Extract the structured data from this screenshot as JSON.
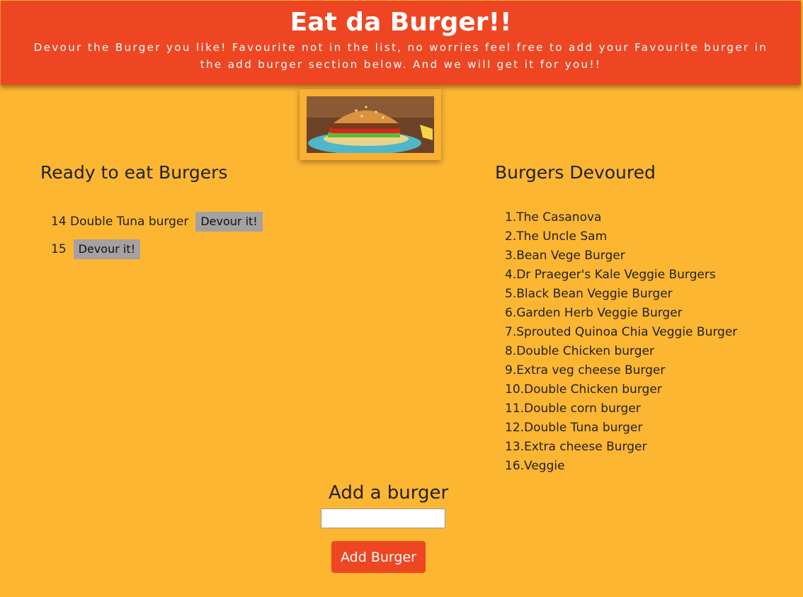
{
  "header": {
    "title": "Eat da Burger!!",
    "subtitle": "Devour the Burger you like! Favourite not in the list, no worries feel free to add your Favourite burger in the add burger section below. And we will get it for you!!"
  },
  "ready": {
    "title": "Ready to eat Burgers",
    "items": [
      {
        "label": "14 Double Tuna burger",
        "button": "Devour it!"
      },
      {
        "label": "15",
        "button": "Devour it!"
      }
    ]
  },
  "devoured": {
    "title": "Burgers Devoured",
    "items": [
      "1.The Casanova",
      "2.The Uncle Sam",
      "3.Bean Vege Burger",
      "4.Dr Praeger's Kale Veggie Burgers",
      "5.Black Bean Veggie Burger",
      "6.Garden Herb Veggie Burger",
      "7.Sprouted Quinoa Chia Veggie Burger",
      "8.Double Chicken burger",
      "9.Extra veg cheese Burger",
      "10.Double Chicken burger",
      "11.Double corn burger",
      "12.Double Tuna burger",
      "13.Extra cheese Burger",
      "16.Veggie"
    ]
  },
  "add": {
    "title": "Add a burger",
    "input_value": "",
    "button": "Add Burger"
  },
  "colors": {
    "background": "#FDB632",
    "header": "#EE4622",
    "devour_button": "#A5A1A1",
    "add_button": "#EE4622"
  }
}
